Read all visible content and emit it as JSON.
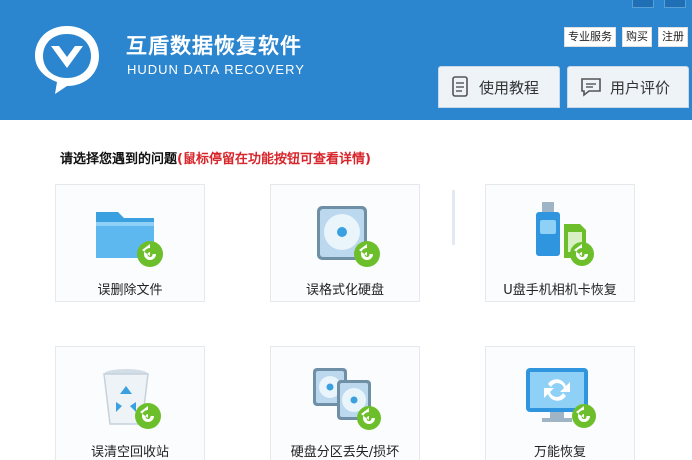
{
  "header": {
    "title": "互盾数据恢复软件",
    "subtitle": "HUDUN DATA RECOVERY",
    "links": [
      "专业服务",
      "购买",
      "注册"
    ],
    "buttons": {
      "tutorial": "使用教程",
      "review": "用户评价"
    }
  },
  "main": {
    "prompt": "请选择您遇到的问题",
    "hint": "(鼠标停留在功能按钮可查看详情)",
    "tiles": [
      {
        "label": "误删除文件",
        "icon": "folder-restore-icon"
      },
      {
        "label": "误格式化硬盘",
        "icon": "disk-restore-icon"
      },
      {
        "label": "U盘手机相机卡恢复",
        "icon": "usb-sd-restore-icon"
      },
      {
        "label": "误清空回收站",
        "icon": "recycle-bin-restore-icon"
      },
      {
        "label": "硬盘分区丢失/损坏",
        "icon": "partition-restore-icon"
      },
      {
        "label": "万能恢复",
        "icon": "universal-restore-icon"
      }
    ]
  },
  "colors": {
    "header": "#2b86cf",
    "hint": "#d7262b",
    "arrow": "#6cbf2a"
  }
}
